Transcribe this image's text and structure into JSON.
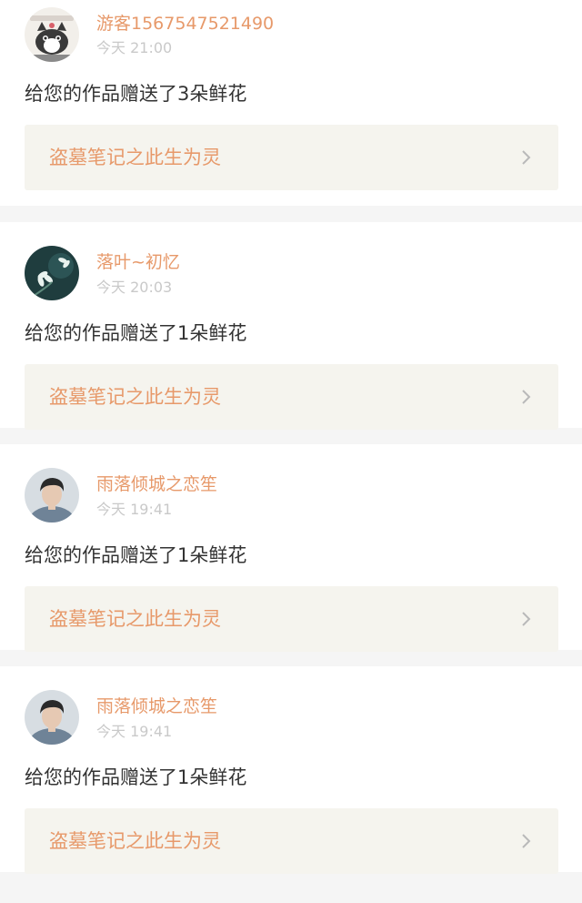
{
  "colors": {
    "accent": "#e7996a",
    "timestamp": "#c9c9c9",
    "message": "#333333",
    "card_link_bg": "#f5f4ee",
    "divider": "#f5f5f5"
  },
  "notifications": [
    {
      "user": "游客1567547521490",
      "time": "今天 21:00",
      "message": "给您的作品赠送了3朵鲜花",
      "work_title": "盗墓笔记之此生为灵",
      "avatar_icon": "cat-avatar-icon"
    },
    {
      "user": "落叶~初忆",
      "time": "今天 20:03",
      "message": "给您的作品赠送了1朵鲜花",
      "work_title": "盗墓笔记之此生为灵",
      "avatar_icon": "flower-avatar-icon"
    },
    {
      "user": "雨落倾城之恋笙",
      "time": "今天 19:41",
      "message": "给您的作品赠送了1朵鲜花",
      "work_title": "盗墓笔记之此生为灵",
      "avatar_icon": "person-avatar-icon"
    },
    {
      "user": "雨落倾城之恋笙",
      "time": "今天 19:41",
      "message": "给您的作品赠送了1朵鲜花",
      "work_title": "盗墓笔记之此生为灵",
      "avatar_icon": "person-avatar-icon"
    }
  ]
}
